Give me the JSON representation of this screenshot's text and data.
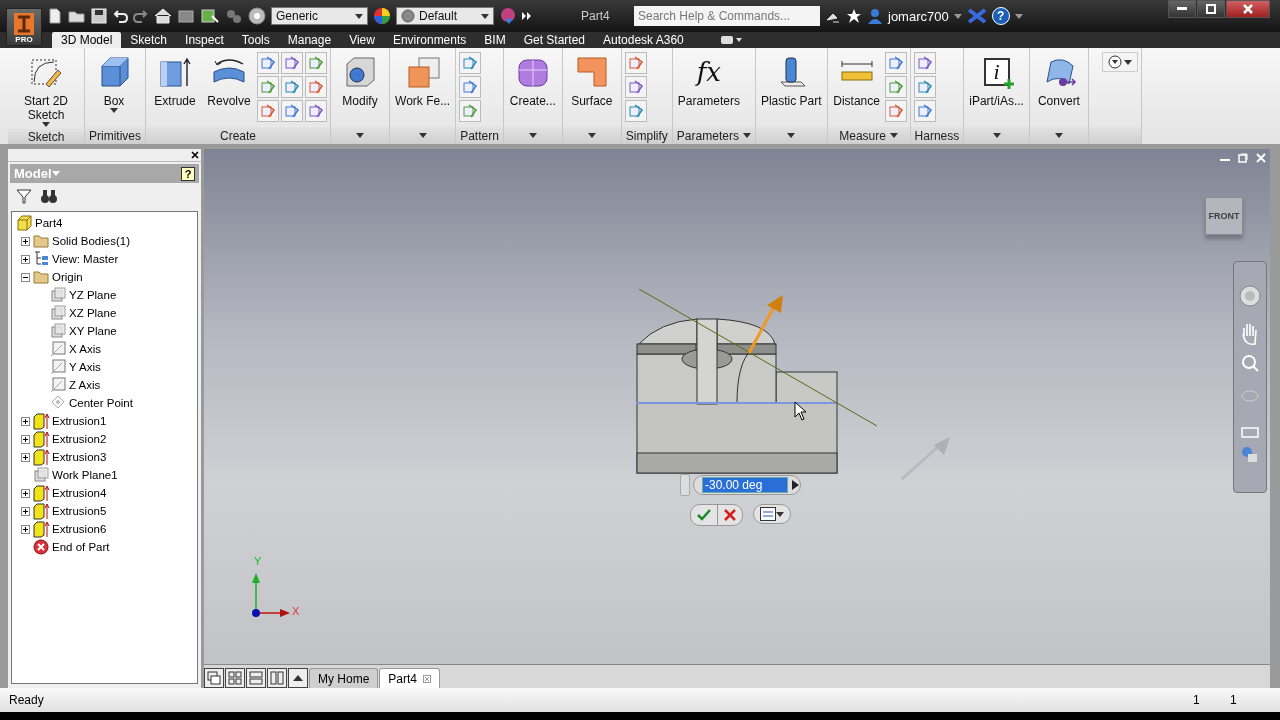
{
  "title_bar": {
    "badge": "PRO",
    "material": "Generic",
    "appearance": "Default",
    "document_title": "Part4",
    "search": {
      "placeholder": "Search Help & Commands..."
    },
    "user": "jomarc700",
    "help": "?"
  },
  "ribbon": {
    "tabs": [
      {
        "label": "3D Model",
        "selected": true
      },
      {
        "label": "Sketch",
        "selected": false
      },
      {
        "label": "Inspect",
        "selected": false
      },
      {
        "label": "Tools",
        "selected": false
      },
      {
        "label": "Manage",
        "selected": false
      },
      {
        "label": "View",
        "selected": false
      },
      {
        "label": "Environments",
        "selected": false
      },
      {
        "label": "BIM",
        "selected": false
      },
      {
        "label": "Get Started",
        "selected": false
      },
      {
        "label": "Autodesk A360",
        "selected": false
      }
    ],
    "panels": [
      {
        "label": "Sketch",
        "caret": false,
        "buttons": [
          {
            "kind": "large",
            "label": "Start 2D Sketch",
            "dropdown": true
          }
        ]
      },
      {
        "label": "Primitives",
        "caret": false,
        "buttons": [
          {
            "kind": "large",
            "label": "Box",
            "dropdown": true
          }
        ]
      },
      {
        "label": "Create",
        "caret": false,
        "buttons": [
          {
            "kind": "large",
            "label": "Extrude",
            "dropdown": false
          },
          {
            "kind": "large",
            "label": "Revolve",
            "dropdown": false
          },
          {
            "kind": "small"
          },
          {
            "kind": "small"
          },
          {
            "kind": "small"
          },
          {
            "kind": "small"
          },
          {
            "kind": "small"
          },
          {
            "kind": "small"
          },
          {
            "kind": "small"
          },
          {
            "kind": "small"
          },
          {
            "kind": "small"
          }
        ]
      },
      {
        "caret": true,
        "buttons": [
          {
            "kind": "large",
            "label": "Modify",
            "dropdown": false
          }
        ]
      },
      {
        "caret": true,
        "buttons": [
          {
            "kind": "large",
            "label": "Work Fe...",
            "dropdown": false
          }
        ]
      },
      {
        "label": "Pattern",
        "caret": false,
        "buttons": [
          {
            "kind": "small"
          },
          {
            "kind": "small"
          },
          {
            "kind": "small"
          }
        ]
      },
      {
        "caret": true,
        "buttons": [
          {
            "kind": "large",
            "label": "Create...",
            "dropdown": false
          }
        ]
      },
      {
        "caret": true,
        "buttons": [
          {
            "kind": "large",
            "label": "Surface",
            "dropdown": false
          }
        ]
      },
      {
        "label": "Simplify",
        "caret": false,
        "buttons": [
          {
            "kind": "small"
          },
          {
            "kind": "small"
          },
          {
            "kind": "small"
          }
        ]
      },
      {
        "label": "Parameters",
        "caret": true,
        "buttons": [
          {
            "kind": "symbol",
            "symbol": "fx",
            "label": "Parameters"
          }
        ]
      },
      {
        "caret": true,
        "buttons": [
          {
            "kind": "large",
            "label": "Plastic Part",
            "dropdown": false
          }
        ]
      },
      {
        "label": "Measure",
        "caret": true,
        "buttons": [
          {
            "kind": "large",
            "label": "Distance",
            "dropdown": false
          },
          {
            "kind": "small"
          },
          {
            "kind": "small"
          },
          {
            "kind": "small"
          }
        ]
      },
      {
        "label": "Harness",
        "caret": false,
        "buttons": [
          {
            "kind": "small"
          },
          {
            "kind": "small"
          },
          {
            "kind": "small"
          }
        ]
      },
      {
        "caret": true,
        "buttons": [
          {
            "kind": "symbol",
            "symbol": "i",
            "label": "iPart/iAs..."
          }
        ]
      },
      {
        "caret": true,
        "buttons": [
          {
            "kind": "large",
            "label": "Convert",
            "dropdown": false
          }
        ]
      },
      {
        "caret": false,
        "buttons": [
          {
            "kind": "menu"
          }
        ]
      }
    ]
  },
  "browser": {
    "title": "Model",
    "help": "?",
    "tree": [
      {
        "label": "Part4",
        "kind": "part",
        "children": [
          {
            "label": "Solid Bodies(1)",
            "kind": "folder",
            "expanded": false
          },
          {
            "label": "View: Master",
            "kind": "view",
            "expanded": false
          },
          {
            "label": "Origin",
            "kind": "folder",
            "expanded": true,
            "children": [
              {
                "label": "YZ Plane",
                "kind": "plane"
              },
              {
                "label": "XZ Plane",
                "kind": "plane"
              },
              {
                "label": "XY Plane",
                "kind": "plane"
              },
              {
                "label": "X Axis",
                "kind": "axis"
              },
              {
                "label": "Y Axis",
                "kind": "axis"
              },
              {
                "label": "Z Axis",
                "kind": "axis"
              },
              {
                "label": "Center Point",
                "kind": "point"
              }
            ]
          },
          {
            "label": "Extrusion1",
            "kind": "extrusion",
            "expanded": false
          },
          {
            "label": "Extrusion2",
            "kind": "extrusion",
            "expanded": false
          },
          {
            "label": "Extrusion3",
            "kind": "extrusion",
            "expanded": false
          },
          {
            "label": "Work Plane1",
            "kind": "plane"
          },
          {
            "label": "Extrusion4",
            "kind": "extrusion",
            "expanded": false
          },
          {
            "label": "Extrusion5",
            "kind": "extrusion",
            "expanded": false
          },
          {
            "label": "Extrusion6",
            "kind": "extrusion",
            "expanded": false
          },
          {
            "label": "End of Part",
            "kind": "end"
          }
        ]
      }
    ]
  },
  "viewport": {
    "view_cube": "FRONT",
    "angle_input": {
      "value": "-30.00 deg",
      "selected": true
    },
    "triad": {
      "x": "X",
      "y": "Y"
    }
  },
  "document_tabs": [
    {
      "label": "My Home",
      "selected": false,
      "closable": false
    },
    {
      "label": "Part4",
      "selected": true,
      "closable": true
    }
  ],
  "status_bar": {
    "message": "Ready",
    "field_1": "1",
    "field_2": "1"
  }
}
